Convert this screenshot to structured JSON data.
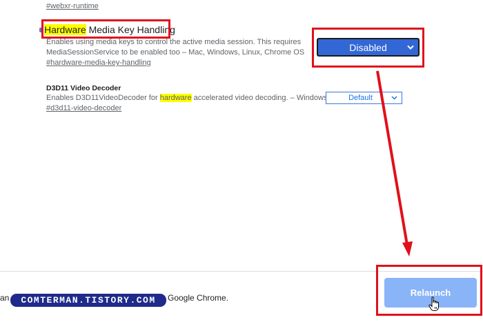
{
  "top_flag": {
    "link": "#webxr-runtime"
  },
  "flag1": {
    "title_highlight": "Hardware",
    "title_rest": " Media Key Handling",
    "desc_line1": "Enables using media keys to control the active media session. This requires",
    "desc_line2": "MediaSessionService to be enabled too – Mac, Windows, Linux, Chrome OS",
    "link": "#hardware-media-key-handling",
    "select_value": "Disabled"
  },
  "flag2": {
    "title": "D3D11 Video Decoder",
    "desc_before": "Enables D3D11VideoDecoder for ",
    "desc_highlight": "hardware",
    "desc_after": " accelerated video decoding. – Windows",
    "link": "#d3d11-video-decoder",
    "select_value": "Default"
  },
  "bottom": {
    "message_left": "an",
    "message_right": "Google Chrome.",
    "relaunch_label": "Relaunch",
    "watermark": "COMTERMAN.TISTORY.COM"
  },
  "colors": {
    "annotation_red": "#e0101a",
    "highlight": "#ffff00",
    "select_blue": "#3367d6",
    "relaunch_blue": "#8ab4f8"
  },
  "icons": {
    "dropdown": "chevron-down-icon",
    "cursor": "hand-pointer-icon"
  }
}
